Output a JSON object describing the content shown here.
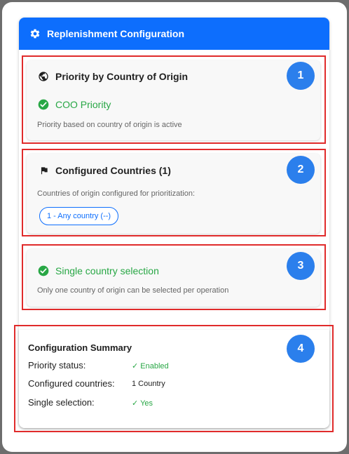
{
  "header": {
    "title": "Replenishment Configuration",
    "icon": "gear-icon",
    "color": "#0d6efd"
  },
  "cards": [
    {
      "number": "1",
      "title": "Priority by Country of Origin",
      "icon": "globe-icon",
      "status": "COO Priority",
      "status_icon": "check-circle-icon",
      "description": "Priority based on country of origin is active"
    },
    {
      "number": "2",
      "title": "Configured Countries (1)",
      "icon": "flag-icon",
      "description": "Countries of origin configured for prioritization:",
      "chip": "1 - Any country (--)"
    },
    {
      "number": "3",
      "status": "Single country selection",
      "status_icon": "check-circle-icon",
      "description": "Only one country of origin can be selected per operation"
    }
  ],
  "summary": {
    "number": "4",
    "title": "Configuration Summary",
    "rows": [
      {
        "label": "Priority status:",
        "value": "✓ Enabled"
      },
      {
        "label": "Configured countries:",
        "value": "1 Country"
      },
      {
        "label": "Single selection:",
        "value": "✓ Yes"
      }
    ]
  },
  "colors": {
    "accent": "#0d6efd",
    "success": "#28a745",
    "highlight": "#e02b2b",
    "badge": "#2b7fec"
  }
}
